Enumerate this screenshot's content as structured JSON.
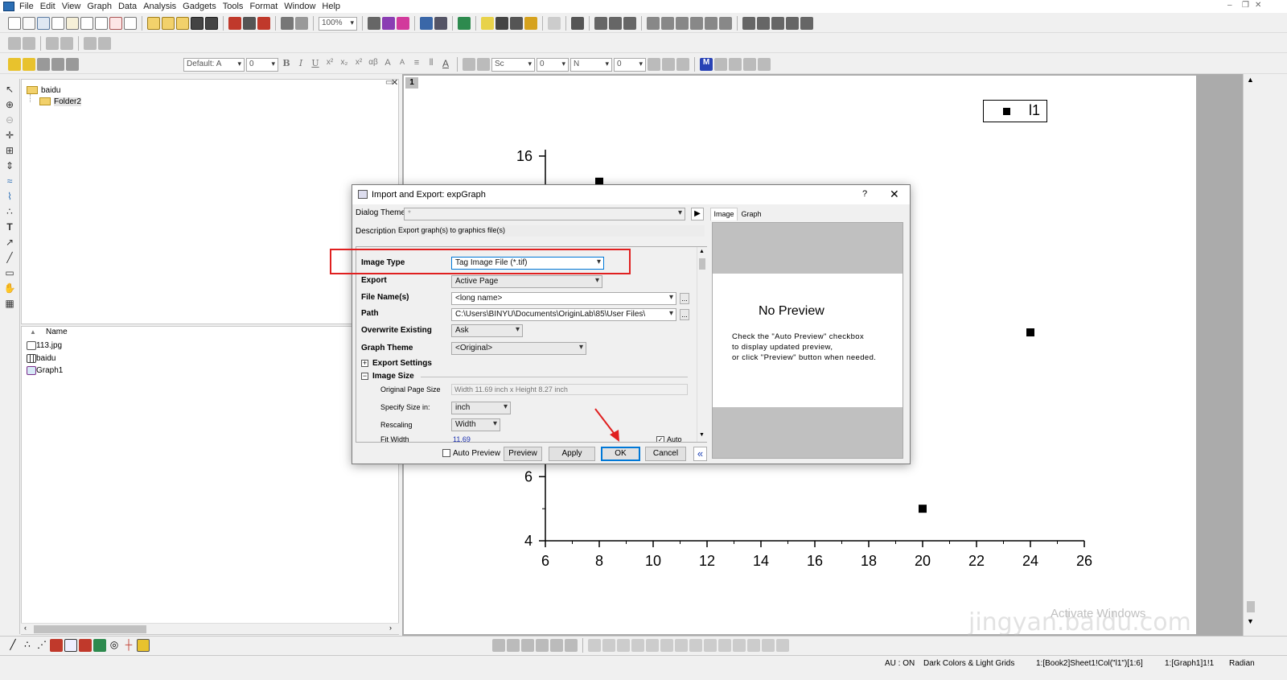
{
  "menu": [
    "File",
    "Edit",
    "View",
    "Graph",
    "Data",
    "Analysis",
    "Gadgets",
    "Tools",
    "Format",
    "Window",
    "Help"
  ],
  "toolbar": {
    "zoom": "100%",
    "font": "Default: A",
    "font_size": "0",
    "line_style": "Sc",
    "line_width": "0",
    "fill_label": "N",
    "fill_value": "0"
  },
  "project_explorer": {
    "root_folder": "baidu",
    "subfolder": "Folder2",
    "column_name": "Name",
    "items": [
      {
        "name": "113.jpg",
        "icon": "image-icon"
      },
      {
        "name": "baidu",
        "icon": "workbook-icon"
      },
      {
        "name": "Graph1",
        "icon": "graph-icon"
      }
    ]
  },
  "graph": {
    "layer_number": "1",
    "legend_label": "l1",
    "y_ticks": [
      "4",
      "6",
      "16"
    ],
    "x_ticks": [
      "6",
      "8",
      "10",
      "12",
      "14",
      "16",
      "18",
      "20",
      "22",
      "24",
      "26"
    ]
  },
  "chart_data": {
    "type": "scatter",
    "series": [
      {
        "name": "l1",
        "points": [
          [
            8,
            15.2
          ],
          [
            24,
            10.5
          ],
          [
            20,
            5.0
          ]
        ]
      }
    ],
    "xlim": [
      6,
      26
    ],
    "ylim": [
      4,
      16.5
    ],
    "x_ticks": [
      6,
      8,
      10,
      12,
      14,
      16,
      18,
      20,
      22,
      24,
      26
    ],
    "y_ticks_visible": [
      4,
      6,
      16
    ],
    "legend_placement": "top-right"
  },
  "dialog": {
    "title": "Import and Export: expGraph",
    "help": "?",
    "close": "✕",
    "dialog_theme_label": "Dialog Theme",
    "dialog_theme_value": "*",
    "description_label": "Description",
    "description_value": "Export graph(s) to graphics file(s)",
    "image_type_label": "Image Type",
    "image_type_value": "Tag Image File (*.tif)",
    "export_label": "Export",
    "export_value": "Active Page",
    "file_name_label": "File Name(s)",
    "file_name_value": "<long name>",
    "path_label": "Path",
    "path_value": "C:\\Users\\BINYU\\Documents\\OriginLab\\85\\User Files\\",
    "overwrite_label": "Overwrite Existing",
    "overwrite_value": "Ask",
    "graph_theme_label": "Graph Theme",
    "graph_theme_value": "<Original>",
    "export_settings": "Export Settings",
    "image_size": "Image Size",
    "original_page_size_label": "Original Page Size",
    "original_page_size_value": "Width 11.69 inch x Height 8.27 inch",
    "specify_size_label": "Specify Size in:",
    "specify_size_value": "inch",
    "rescaling_label": "Rescaling",
    "rescaling_value": "Width",
    "fit_width_label": "Fit Width",
    "fit_width_value": "11.69",
    "auto_label": "Auto",
    "auto_preview_label": "Auto Preview",
    "preview_button": "Preview",
    "apply_button": "Apply",
    "ok_button": "OK",
    "cancel_button": "Cancel",
    "collapse_button": "«",
    "browse": "...",
    "tabs": [
      "Image",
      "Graph"
    ],
    "no_preview_title": "No Preview",
    "no_preview_lines": [
      "Check the \"Auto Preview\" checkbox",
      "to display updated preview,",
      "or click \"Preview\" button when needed."
    ]
  },
  "status": {
    "au": "AU : ON",
    "theme": "Dark Colors & Light Grids",
    "cell": "1:[Book2]Sheet1!Col(\"l1\")[1:6]",
    "layer": "1:[Graph1]1!1",
    "angle": "Radian"
  },
  "watermark": {
    "line1": "Activate Windows",
    "line2": "jingyan.baidu.com"
  },
  "colors": {
    "highlight_box": "#e02020",
    "arrow": "#e02020",
    "default_button_border": "#0078d7"
  }
}
